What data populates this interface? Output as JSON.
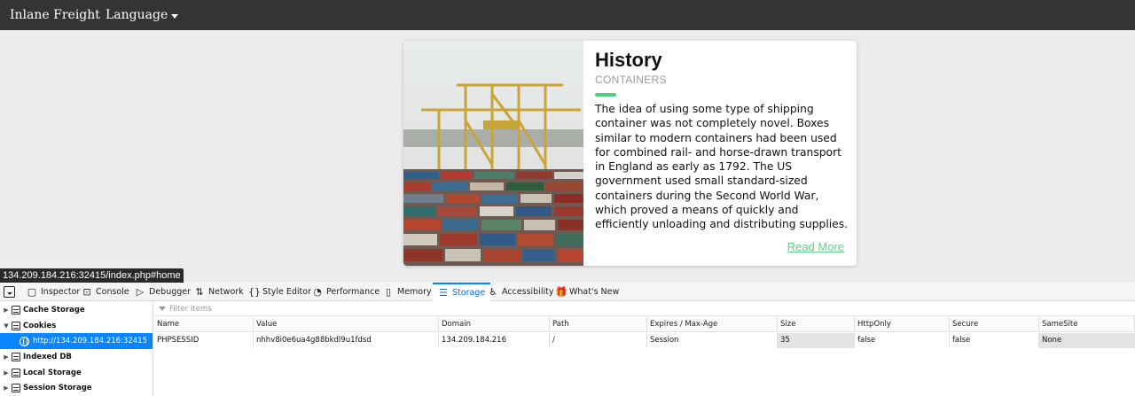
{
  "navbar": {
    "brand": "Inlane Freight",
    "language": "Language"
  },
  "card": {
    "title": "History",
    "subtitle": "CONTAINERS",
    "description": "The idea of using some type of shipping container was not completely novel. Boxes similar to modern containers had been used for combined rail- and horse-drawn transport in England as early as 1792. The US government used small standard-sized containers during the Second World War, which proved a means of quickly and efficiently unloading and distributing supplies.",
    "read_more": "Read More",
    "accent_color": "#4cd07a"
  },
  "status_url": "134.209.184.216:32415/index.php#home",
  "devtools": {
    "tabs": [
      {
        "label": "Inspector",
        "icon": "inspector-icon"
      },
      {
        "label": "Console",
        "icon": "console-icon"
      },
      {
        "label": "Debugger",
        "icon": "debugger-icon"
      },
      {
        "label": "Network",
        "icon": "network-icon"
      },
      {
        "label": "Style Editor",
        "icon": "style-editor-icon"
      },
      {
        "label": "Performance",
        "icon": "performance-icon"
      },
      {
        "label": "Memory",
        "icon": "memory-icon"
      },
      {
        "label": "Storage",
        "icon": "storage-icon",
        "active": true
      },
      {
        "label": "Accessibility",
        "icon": "accessibility-icon"
      },
      {
        "label": "What's New",
        "icon": "gift-icon"
      }
    ],
    "sidebar": [
      {
        "label": "Cache Storage",
        "expanded": false
      },
      {
        "label": "Cookies",
        "expanded": true
      },
      {
        "label": "http://134.209.184.216:32415",
        "child": true,
        "selected": true
      },
      {
        "label": "Indexed DB",
        "expanded": false
      },
      {
        "label": "Local Storage",
        "expanded": false
      },
      {
        "label": "Session Storage",
        "expanded": false
      }
    ],
    "filter_placeholder": "Filter Items",
    "columns": [
      "Name",
      "Value",
      "Domain",
      "Path",
      "Expires / Max-Age",
      "Size",
      "HttpOnly",
      "Secure",
      "SameSite"
    ],
    "rows": [
      [
        "PHPSESSID",
        "nhhv8i0e6ua4g88bkdl9u1fdsd",
        "134.209.184.216",
        "/",
        "Session",
        "35",
        "false",
        "false",
        "None"
      ]
    ]
  }
}
